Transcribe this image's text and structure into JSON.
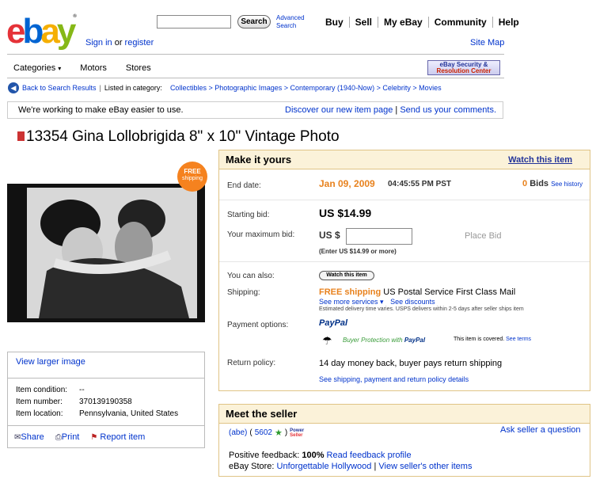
{
  "header": {
    "search_button": "Search",
    "advanced_search_line1": "Advanced",
    "advanced_search_line2": "Search",
    "nav": [
      "Buy",
      "Sell",
      "My eBay",
      "Community",
      "Help"
    ],
    "sign_in": "Sign in",
    "or": "or",
    "register": "register",
    "site_map": "Site Map",
    "categories": "Categories",
    "motors": "Motors",
    "stores": "Stores",
    "security_line1": "eBay Security &",
    "security_line2": "Resolution Center"
  },
  "breadcrumb": {
    "back": "Back to Search Results",
    "listed": "Listed in category:",
    "path": "Collectibles > Photographic Images > Contemporary (1940-Now) > Celebrity > Movies"
  },
  "notice": {
    "text": "We're working to make eBay easier to use.",
    "link1": "Discover our new item page",
    "link2": "Send us your comments."
  },
  "item": {
    "title": "13354 Gina Lollobrigida 8\" x 10\" Vintage Photo",
    "free_line1": "FREE",
    "free_line2": "shipping"
  },
  "left": {
    "view_larger": "View larger image",
    "condition_label": "Item condition:",
    "condition_value": "--",
    "number_label": "Item number:",
    "number_value": "370139190358",
    "location_label": "Item location:",
    "location_value": "Pennsylvania, United States",
    "share": "Share",
    "print": "Print",
    "report": "Report item"
  },
  "panel": {
    "title": "Make it yours",
    "watch_link": "Watch this item",
    "end_label": "End date:",
    "end_date": "Jan 09, 2009",
    "end_time": "04:45:55 PM PST",
    "bids_count": "0",
    "bids_label": "Bids",
    "see_history": "See history",
    "starting_label": "Starting bid:",
    "starting_value": "US $14.99",
    "max_label": "Your maximum bid:",
    "currency": "US $",
    "max_hint": "(Enter US $14.99 or more)",
    "place_bid": "Place Bid",
    "also_label": "You can also:",
    "watch_button": "Watch this item",
    "shipping_label": "Shipping:",
    "free_shipping": "FREE shipping",
    "ship_service": "US Postal Service First Class Mail",
    "see_more": "See more services",
    "see_discounts": "See discounts",
    "ship_note": "Estimated delivery time varies. USPS delivers within 2-5 days after seller ships item",
    "payment_label": "Payment options:",
    "paypal": "PayPal",
    "protection_a": "Buyer Protection with",
    "protection_b": "PayPal",
    "covered": "This item is covered.",
    "see_terms": "See terms",
    "return_label": "Return policy:",
    "return_value": "14 day money back, buyer pays return shipping",
    "return_link": "See shipping, payment and return policy details"
  },
  "seller": {
    "title": "Meet the seller",
    "name": "(abe)",
    "paren_open": "(",
    "feedback_score": "5602",
    "paren_close": ")",
    "power_line1": "Power",
    "power_line2": "Seller",
    "ask": "Ask seller a question",
    "positive_label": "Positive feedback:",
    "positive_value": "100%",
    "read_feedback": "Read feedback profile",
    "store_label": "eBay Store:",
    "store_name": "Unforgettable Hollywood",
    "other_items": "View seller's other items"
  },
  "colors": {
    "accent_orange": "#e8821e",
    "link_blue": "#0033cc",
    "panel_border": "#e0c486"
  }
}
